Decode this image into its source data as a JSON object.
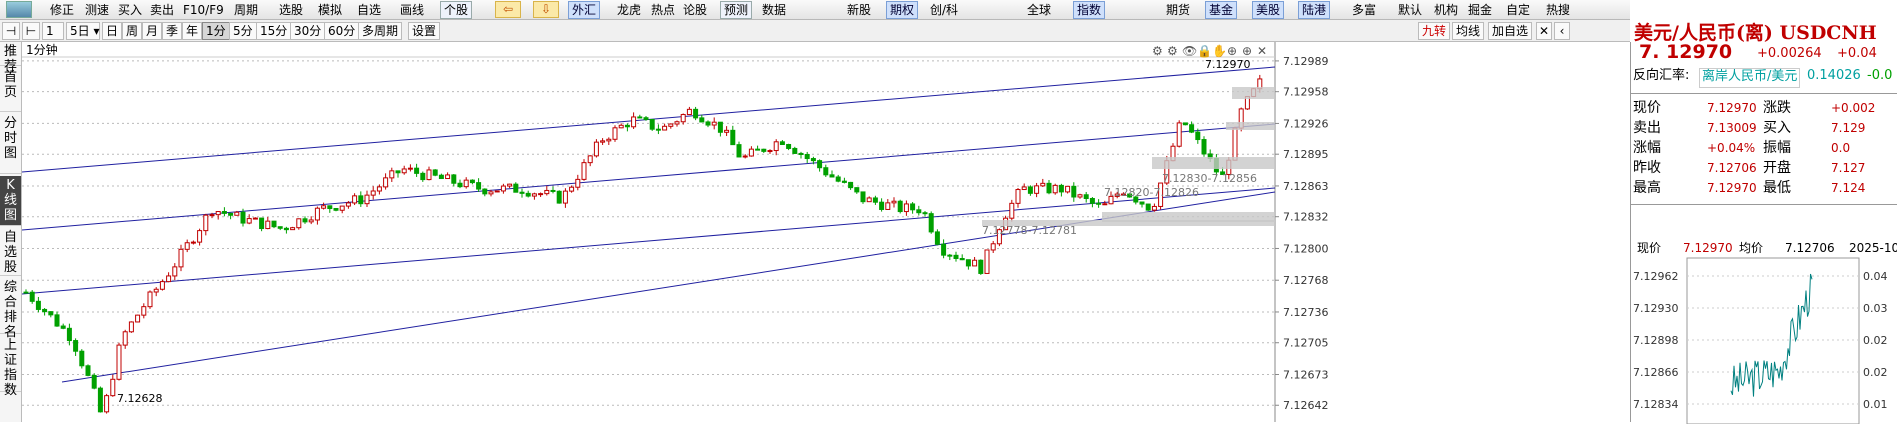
{
  "toolbar": {
    "items": [
      "修正",
      "测速",
      "买入",
      "卖出",
      "F10/F9",
      "周期",
      "选股",
      "模拟",
      "自选",
      "画线",
      "个股",
      "",
      "",
      "外汇",
      "龙虎",
      "热点",
      "论股",
      "预测",
      "数据",
      "新股",
      "期权",
      "创/科",
      "全球",
      "指数",
      "期货",
      "基金",
      "美股",
      "陆港",
      "多富",
      "默认",
      "机构",
      "掘金",
      "自定",
      "热搜"
    ]
  },
  "quote": {
    "title": "美元/人民币(离) USDCNH",
    "last": "7. 12970",
    "change": "+0.00264",
    "pct": "+0.04",
    "reverse_label": "反向汇率:",
    "reverse_pair": "离岸人民币/美元",
    "reverse_value": "0.14026",
    "reverse_change": "-0.0",
    "rows": [
      {
        "l1": "现价",
        "v1": "7.12970",
        "l2": "涨跌",
        "v2": "+0.002"
      },
      {
        "l1": "卖出",
        "v1": "7.13009",
        "l2": "买入",
        "v2": "7.129"
      },
      {
        "l1": "涨幅",
        "v1": "+0.04%",
        "l2": "振幅",
        "v2": "0.0"
      },
      {
        "l1": "昨收",
        "v1": "7.12706",
        "l2": "开盘",
        "v2": "7.127"
      },
      {
        "l1": "最高",
        "v1": "7.12970",
        "l2": "最低",
        "v2": "7.124"
      }
    ],
    "mini": {
      "label_now": "现价",
      "now": "7.12970",
      "label_avg": "均价",
      "avg": "7.12706",
      "date": "2025-10",
      "yticks": [
        "7.12962",
        "7.12930",
        "7.12898",
        "7.12866",
        "7.12834"
      ],
      "rticks": [
        "0.04",
        "0.03",
        "0.02",
        "0.02",
        "0.01"
      ]
    }
  },
  "periods": {
    "items": [
      "5日",
      "日",
      "周",
      "月",
      "季",
      "年",
      "1分",
      "5分",
      "15分",
      "30分",
      "60分",
      "多周期",
      "设置"
    ],
    "selected": "1分",
    "label": "1分钟"
  },
  "left_tabs": [
    {
      "label": "推荐",
      "sel": false
    },
    {
      "label": "首页",
      "sel": false
    },
    {
      "label": "分时图",
      "sel": false
    },
    {
      "label": "K线图",
      "sel": true
    },
    {
      "label": "自选股",
      "sel": false
    },
    {
      "label": "综合排名",
      "sel": false
    },
    {
      "label": "上证指数",
      "sel": false
    }
  ],
  "top_right_buttons": [
    "九转",
    "均线",
    "加自选"
  ],
  "chart_data": {
    "type": "candlestick",
    "yticks": [
      "7.12989",
      "7.12958",
      "7.12926",
      "7.12895",
      "7.12863",
      "7.12832",
      "7.12800",
      "7.12768",
      "7.12736",
      "7.12705",
      "7.12673",
      "7.12642"
    ],
    "ymin": 7.1261,
    "ymax": 7.13,
    "annotations": [
      {
        "text": "7.12970"
      },
      {
        "text": "7.12628"
      },
      {
        "text": "7.12820-7.12826"
      },
      {
        "text": "7.12830-7.12856"
      },
      {
        "text": "7.12778-7.12781"
      }
    ]
  },
  "icons": [
    "gear-icon",
    "settings-icon",
    "eye-icon",
    "lock-icon",
    "hand-icon",
    "zoom-in-icon",
    "plus-icon",
    "close-icon"
  ]
}
